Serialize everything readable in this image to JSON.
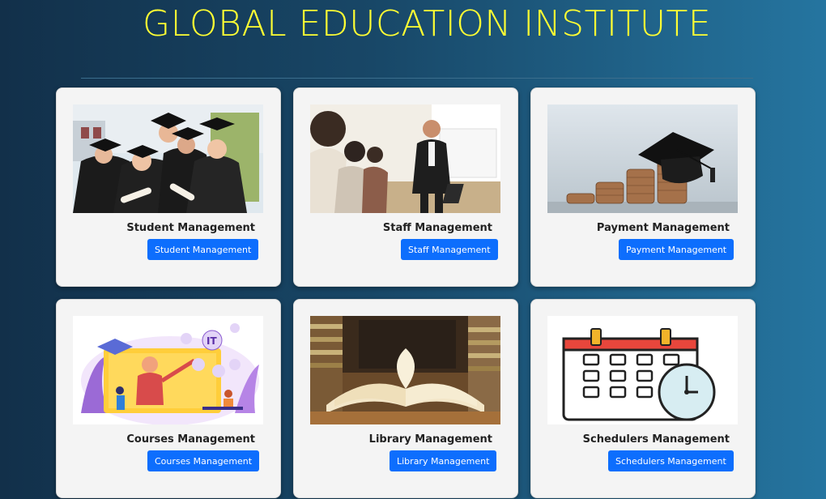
{
  "header": {
    "title": "GLOBAL EDUCATION INSTITUTE"
  },
  "colors": {
    "title": "#ffff33",
    "button": "#0d6efd",
    "card": "#f4f4f4"
  },
  "cards": [
    {
      "label": "Student Management",
      "button": "Student Management",
      "image": "graduates-photo"
    },
    {
      "label": "Staff Management",
      "button": "Staff Management",
      "image": "classroom-photo"
    },
    {
      "label": "Payment Management",
      "button": "Payment Management",
      "image": "coins-graduation-cap-photo"
    },
    {
      "label": "Courses Management",
      "button": "Courses Management",
      "image": "online-course-illustration"
    },
    {
      "label": "Library Management",
      "button": "Library Management",
      "image": "open-book-photo"
    },
    {
      "label": "Schedulers Management",
      "button": "Schedulers Management",
      "image": "calendar-clock-icon"
    }
  ]
}
